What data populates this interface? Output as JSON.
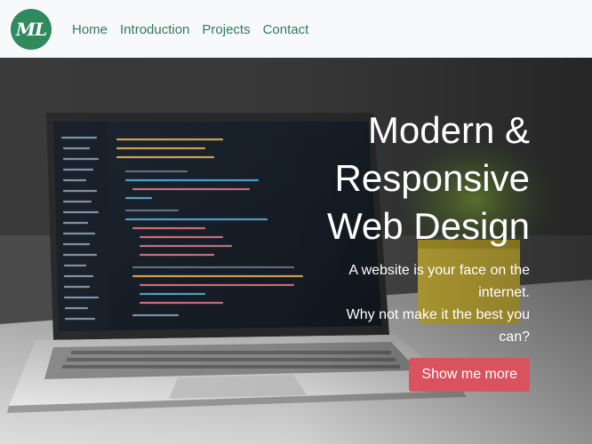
{
  "brand": {
    "logo_text": "ML",
    "logo_color": "#2f8a5e"
  },
  "nav": {
    "items": [
      {
        "label": "Home"
      },
      {
        "label": "Introduction"
      },
      {
        "label": "Projects"
      },
      {
        "label": "Contact"
      }
    ],
    "link_color": "#2e7d5b"
  },
  "hero": {
    "title_lines": [
      "Modern &",
      "Responsive",
      "Web Design"
    ],
    "subtitle_lines": [
      "A website is your face on the",
      "internet.",
      "Why not make it the best you",
      "can?"
    ],
    "button_label": "Show me more",
    "button_color": "#d9535f"
  }
}
